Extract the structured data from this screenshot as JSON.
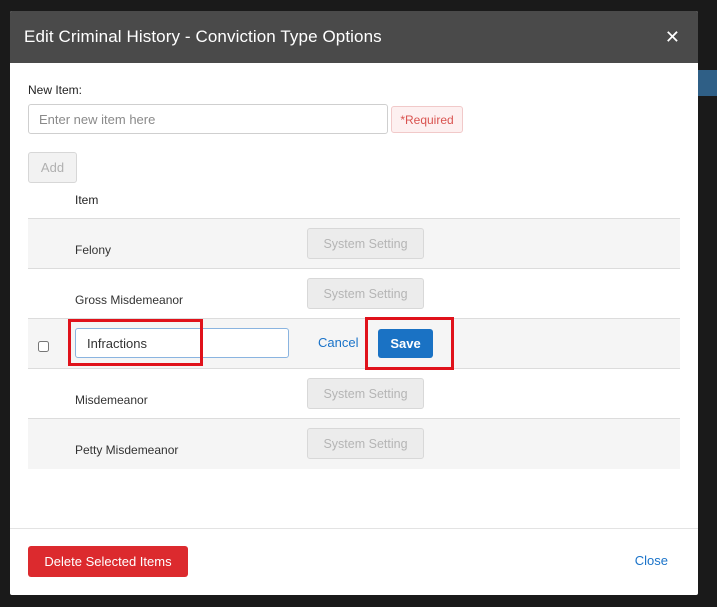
{
  "modal": {
    "title": "Edit Criminal History - Conviction Type Options",
    "close_glyph": "✕"
  },
  "new_item": {
    "label": "New Item:",
    "placeholder": "Enter new item here",
    "value": "",
    "required_text": "*Required",
    "add_label": "Add"
  },
  "table": {
    "header_item": "Item",
    "rows": [
      {
        "name": "Felony",
        "button": "System Setting"
      },
      {
        "name": "Gross Misdemeanor",
        "button": "System Setting"
      },
      {
        "name": "Infractions",
        "editing": true,
        "cancel_label": "Cancel",
        "save_label": "Save"
      },
      {
        "name": "Misdemeanor",
        "button": "System Setting"
      },
      {
        "name": "Petty Misdemeanor",
        "button": "System Setting"
      }
    ]
  },
  "footer": {
    "delete_label": "Delete Selected Items",
    "close_label": "Close"
  },
  "colors": {
    "header_bg": "#4a4a4a",
    "primary_blue": "#1a72c4",
    "danger_red": "#dc2a2e",
    "highlight_red": "#e0121b"
  }
}
